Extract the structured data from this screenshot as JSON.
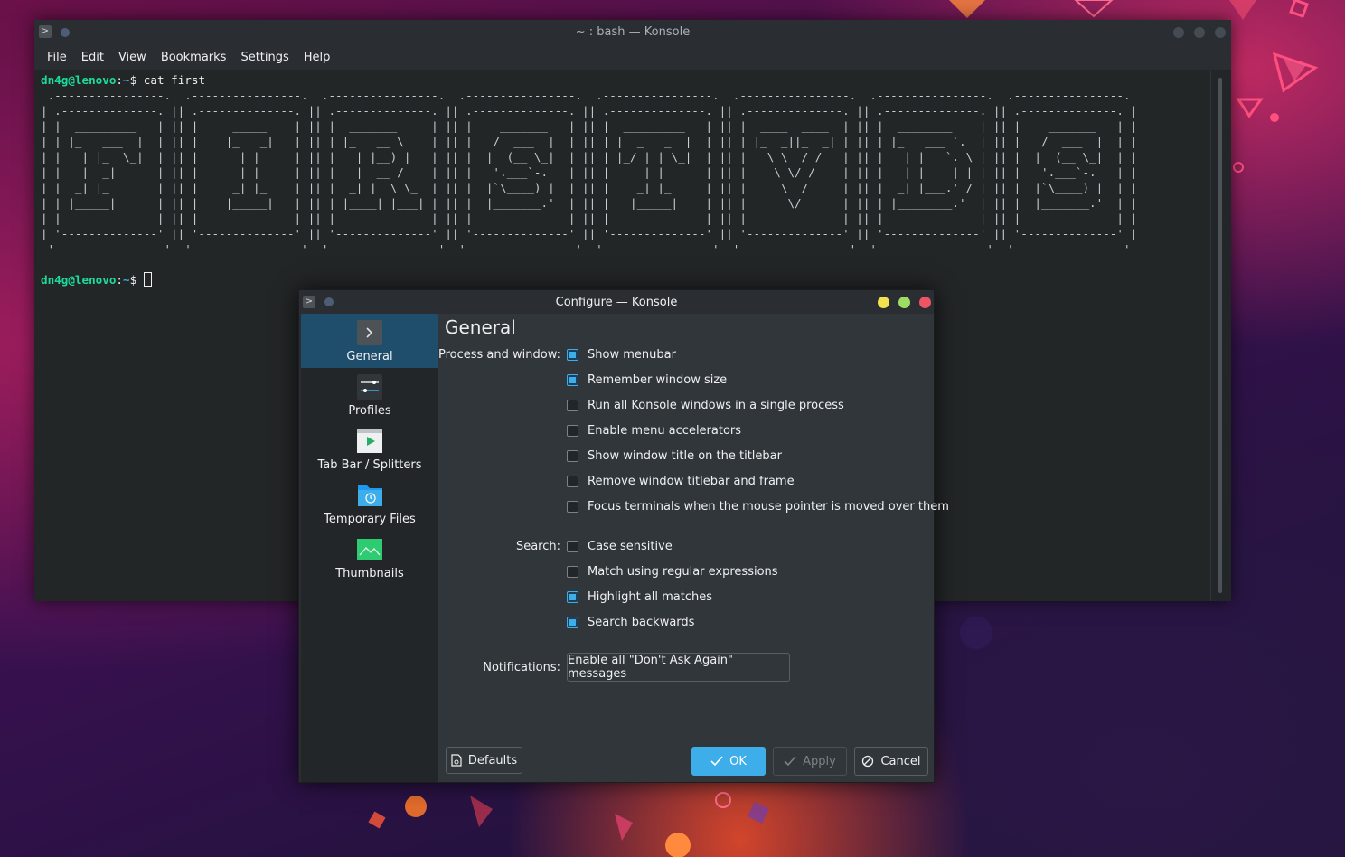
{
  "konsole": {
    "title": "~ : bash — Konsole",
    "menu": [
      "File",
      "Edit",
      "View",
      "Bookmarks",
      "Settings",
      "Help"
    ],
    "prompt_user": "dn4g@lenovo",
    "prompt_sep": ":",
    "prompt_path": "~",
    "prompt_suffix": "$",
    "command": "cat first",
    "ascii_art": " .----------------.  .----------------.  .----------------.  .----------------.  .----------------.  .----------------.  .----------------.  .----------------.\n| .--------------. || .--------------. || .--------------. || .--------------. || .--------------. || .--------------. || .--------------. || .--------------. |\n| |  _________   | || |     _____    | || |  _______     | || |    _______   | || |  _________   | || |  ____  ____  | || |  ________    | || |    _______   | |\n| | |_   ___  |  | || |    |_   _|   | || | |_   __ \\    | || |   /  ___  |  | || | |  _   _  |  | || | |_  _||_  _| | || | |_   ___ `.  | || |   /  ___  |  | |\n| |   | |_  \\_|  | || |      | |     | || |   | |__) |   | || |  |  (__ \\_|  | || | |_/ | | \\_|  | || |   \\ \\  / /   | || |   | |   `. \\ | || |  |  (__ \\_|  | |\n| |   |  _|      | || |      | |     | || |   |  __ /    | || |   '.___`-.   | || |     | |      | || |    \\ \\/ /    | || |   | |    | | | || |   '.___`-.   | |\n| |  _| |_       | || |     _| |_    | || |  _| |  \\ \\_  | || |  |`\\____) |  | || |    _| |_     | || |     \\  /     | || |  _| |___.' / | || |  |`\\____) |  | |\n| | |_____|      | || |    |_____|   | || | |____| |___| | || |  |_______.'  | || |   |_____|    | || |      \\/      | || | |________.'  | || |  |_______.'  | |\n| |              | || |              | || |              | || |              | || |              | || |              | || |              | || |              | |\n| '--------------' || '--------------' || '--------------' || '--------------' || '--------------' || '--------------' || '--------------' || '--------------' |\n '----------------'  '----------------'  '----------------'  '----------------'  '----------------'  '----------------'  '----------------'  '----------------'"
  },
  "dialog": {
    "title": "Configure — Konsole",
    "sidebar": [
      {
        "label": "General",
        "icon": "konsole-app-icon"
      },
      {
        "label": "Profiles",
        "icon": "sliders-icon"
      },
      {
        "label": "Tab Bar / Splitters",
        "icon": "tab-bar-icon"
      },
      {
        "label": "Temporary Files",
        "icon": "folder-clock-icon"
      },
      {
        "label": "Thumbnails",
        "icon": "image-icon"
      }
    ],
    "heading": "General",
    "process_label": "Process and window:",
    "process_options": [
      {
        "label": "Show menubar",
        "checked": true
      },
      {
        "label": "Remember window size",
        "checked": true
      },
      {
        "label": "Run all Konsole windows in a single process",
        "checked": false
      },
      {
        "label": "Enable menu accelerators",
        "checked": false
      },
      {
        "label": "Show window title on the titlebar",
        "checked": false
      },
      {
        "label": "Remove window titlebar and frame",
        "checked": false
      },
      {
        "label": "Focus terminals when the mouse pointer is moved over them",
        "checked": false
      }
    ],
    "search_label": "Search:",
    "search_options": [
      {
        "label": "Case sensitive",
        "checked": false
      },
      {
        "label": "Match using regular expressions",
        "checked": false
      },
      {
        "label": "Highlight all matches",
        "checked": true
      },
      {
        "label": "Search backwards",
        "checked": true
      }
    ],
    "notifications_label": "Notifications:",
    "notifications_button": "Enable all \"Don't Ask Again\" messages",
    "buttons": {
      "defaults": "Defaults",
      "ok": "OK",
      "apply": "Apply",
      "cancel": "Cancel"
    }
  },
  "colors": {
    "accent": "#3daee9",
    "prompt_user": "#1cdc9a",
    "close": "#ed5565",
    "minimize": "#f2e24f",
    "maximize": "#9fdd62"
  }
}
